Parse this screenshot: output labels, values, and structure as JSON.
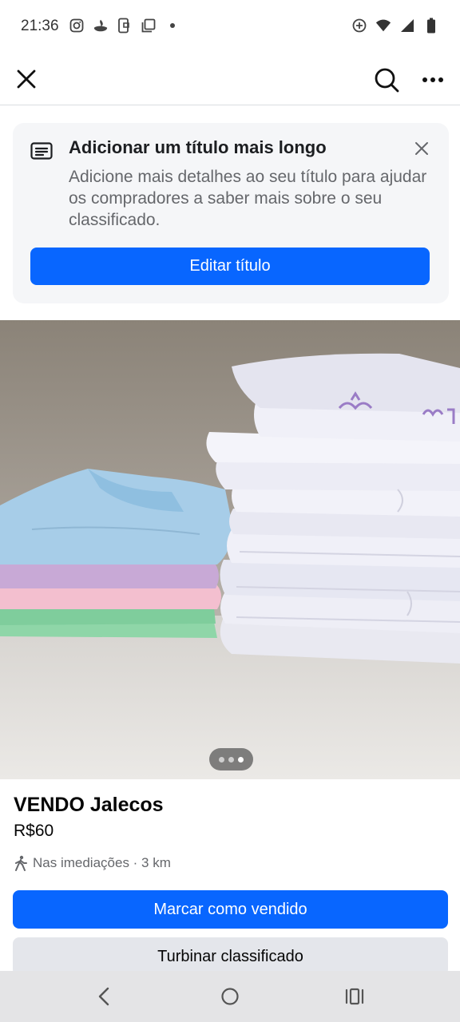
{
  "status_bar": {
    "time": "21:36",
    "left_icons": [
      "instagram-icon",
      "santander-icon",
      "phone-link-icon",
      "copy-icon",
      "dot-icon"
    ],
    "right_icons": [
      "data-saver-icon",
      "wifi-icon",
      "signal-icon",
      "battery-icon"
    ]
  },
  "top_bar": {
    "icons": [
      "close-icon",
      "search-icon",
      "more-icon"
    ]
  },
  "tip": {
    "title": "Adicionar um título mais longo",
    "body": "Adicione mais detalhes ao seu título para ajudar os compradores a saber mais sobre o seu classificado.",
    "button": "Editar título",
    "icon": "article-icon"
  },
  "image": {
    "description_icon": "product-photo",
    "pager_count": 3,
    "pager_active": 3
  },
  "listing": {
    "title": "VENDO Jalecos",
    "price": "R$60",
    "location": "Nas imediações · 3 km",
    "location_icon": "walking-icon"
  },
  "actions": {
    "primary": "Marcar como vendido",
    "secondary": "Turbinar classificado"
  },
  "colors": {
    "accent": "#0866ff",
    "secondary_button": "#e4e6eb",
    "card_background": "#f5f6f8"
  },
  "nav_bar": {
    "icons": [
      "back-icon",
      "home-icon",
      "recents-icon"
    ]
  }
}
